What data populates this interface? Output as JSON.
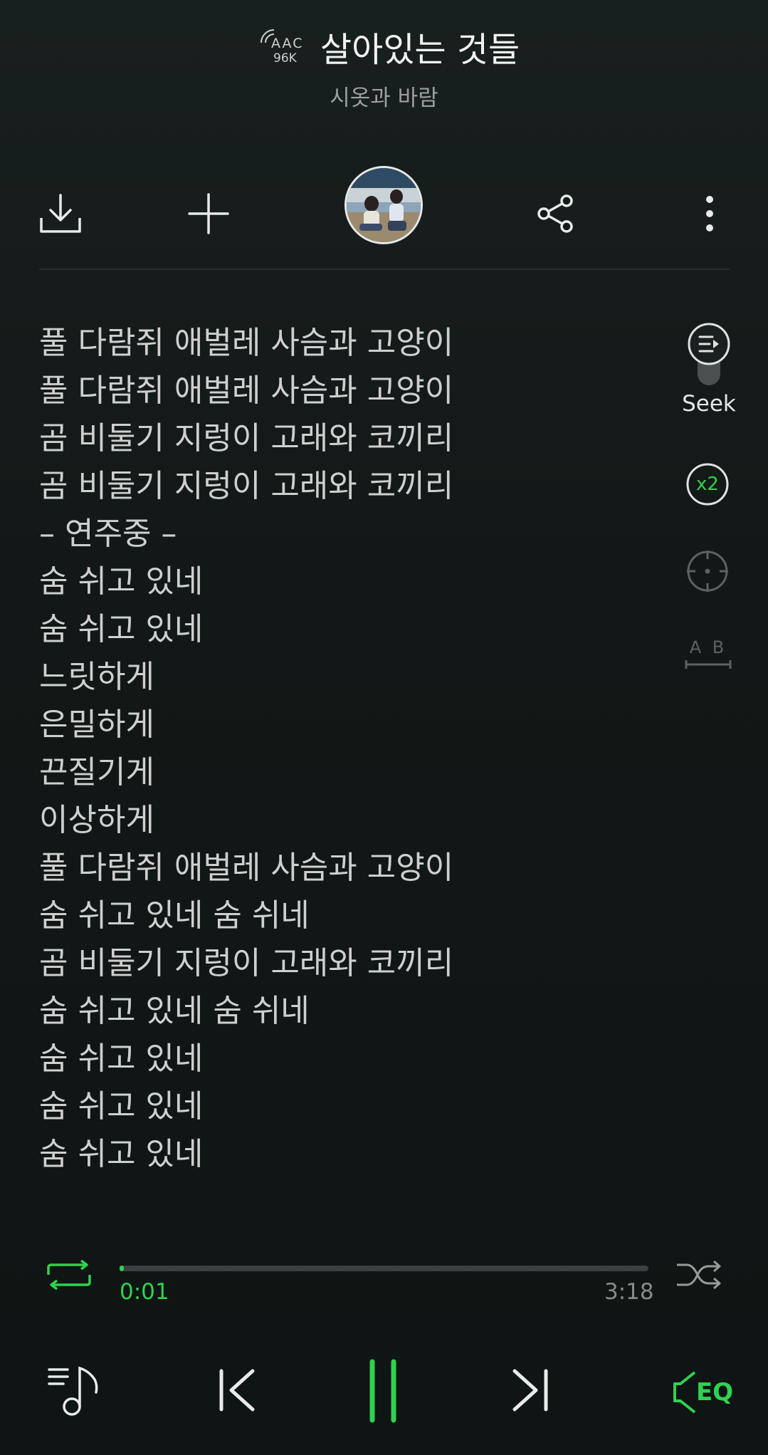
{
  "header": {
    "codec": "AAC",
    "bitrate": "96K",
    "title": "살아있는 것들",
    "artist": "시옷과 바람"
  },
  "actions": {
    "download_icon": "download-icon",
    "add_icon": "plus-icon",
    "share_icon": "share-icon",
    "more_icon": "more-vertical-icon"
  },
  "side_controls": {
    "seek_label": "Seek",
    "speed_label": "x2",
    "ab_label": "A B"
  },
  "lyrics": [
    "풀 다람쥐 애벌레 사슴과 고양이",
    "풀 다람쥐 애벌레 사슴과 고양이",
    "곰 비둘기 지렁이 고래와 코끼리",
    "곰 비둘기 지렁이 고래와 코끼리",
    "– 연주중 –",
    "숨 쉬고 있네",
    "숨 쉬고 있네",
    "느릿하게",
    "은밀하게",
    "끈질기게",
    "이상하게",
    "풀 다람쥐 애벌레 사슴과 고양이",
    "숨 쉬고 있네 숨 쉬네",
    "곰 비둘기 지렁이 고래와 코끼리",
    "숨 쉬고 있네 숨 쉬네",
    "숨 쉬고 있네",
    "숨 쉬고 있네",
    "숨 쉬고 있네"
  ],
  "playback": {
    "current_time": "0:01",
    "total_time": "3:18",
    "progress_fraction": 0.005,
    "eq_label": "EQ"
  },
  "colors": {
    "accent": "#2fd24f",
    "background": "#121817",
    "text": "#cfcfcf"
  }
}
